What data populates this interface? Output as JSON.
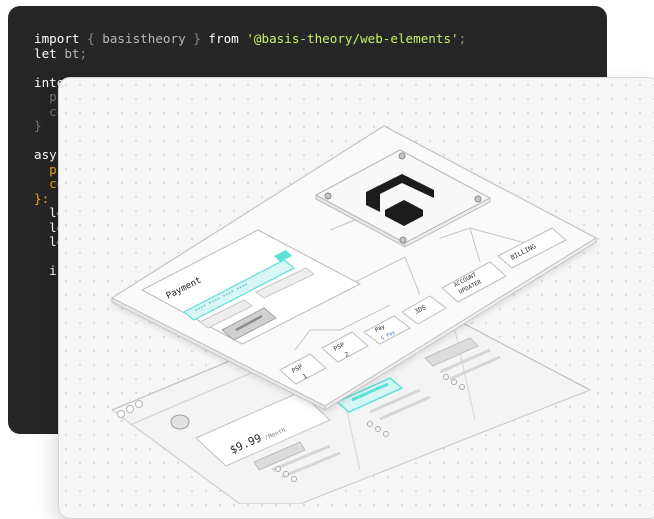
{
  "code": {
    "lines": [
      {
        "kw1": "import",
        "p1": " { ",
        "id1": "basistheory",
        "p2": " } ",
        "kw2": "from",
        "str": " '@basis-theory/web-elements'",
        "p3": ";"
      },
      {
        "kw1": "let",
        "id1": " bt",
        "p1": ";"
      },
      {
        "kw1": "inte"
      },
      {
        "dim1": "  pi"
      },
      {
        "dim1": "  co"
      },
      {
        "dim1": "}"
      },
      {
        "kw1": "asy"
      },
      {
        "orange1": "  pr"
      },
      {
        "orange1": "  co"
      },
      {
        "orange1": "}: ("
      },
      {
        "kw1": "  le"
      },
      {
        "kw1": "  le"
      },
      {
        "kw1": "  le"
      },
      {
        "kw1": ""
      },
      {
        "kw1": "  i:"
      }
    ]
  },
  "diagram": {
    "payment_label": "Payment",
    "masked_card": "**** **** **** ****",
    "nodes": {
      "billing": "BILLING",
      "account_updater_1": "ACCOUNT",
      "account_updater_2": "UPDATER",
      "three_ds": "3DS",
      "apple_pay": "Pay",
      "google_pay": "G Pay",
      "psp2_a": "PSP",
      "psp2_b": "2",
      "psp1_a": "PSP",
      "psp1_b": "1"
    },
    "price": "$9.99",
    "price_unit": "/Month"
  },
  "colors": {
    "code_bg": "#262627",
    "string": "#c6f26a",
    "accent_teal": "#5fe0d8",
    "accent_teal_fill": "#d6f7f4",
    "logo_black": "#1c1c1c"
  }
}
